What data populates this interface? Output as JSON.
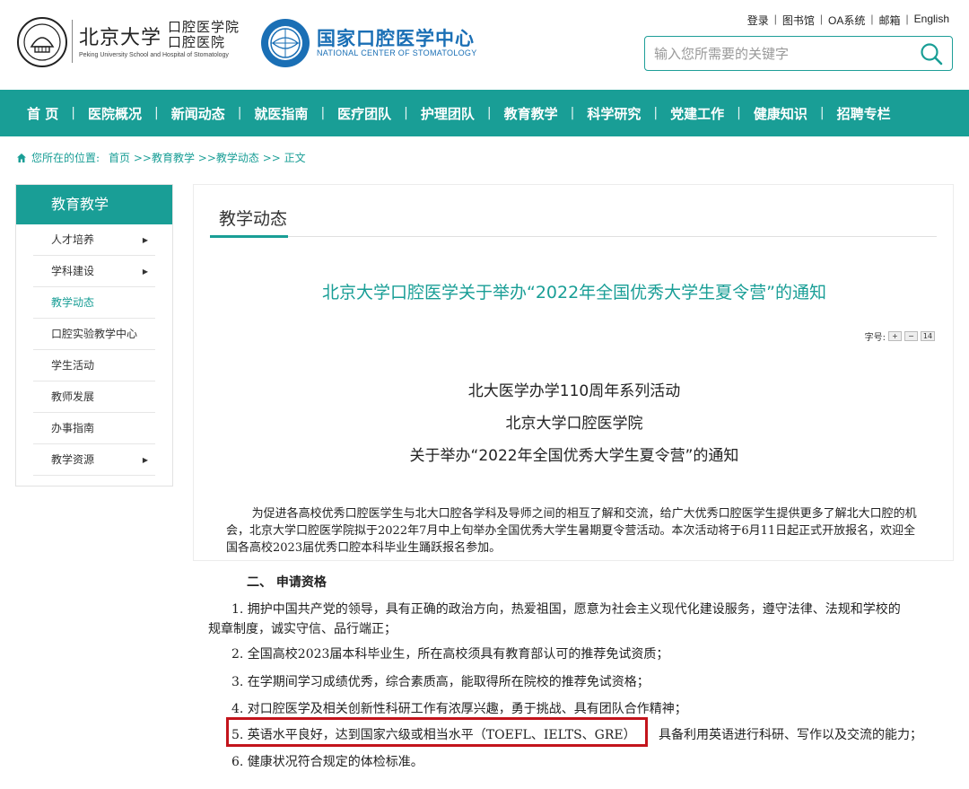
{
  "header": {
    "pku_name": "北京大学",
    "pku_school_cn": "口腔医学院 口腔医院",
    "pku_school_en": "Peking University School and Hospital of Stomatology",
    "ncs_name_cn": "国家口腔医学中心",
    "ncs_name_en": "NATIONAL CENTER OF STOMATOLOGY",
    "top_links": [
      "登录",
      "图书馆",
      "OA系统",
      "邮箱",
      "English"
    ],
    "search_placeholder": "输入您所需要的关键字",
    "brand_color": "#199e96",
    "ncs_color": "#1a6fb5"
  },
  "nav": {
    "items": [
      "首 页",
      "医院概况",
      "新闻动态",
      "就医指南",
      "医疗团队",
      "护理团队",
      "教育教学",
      "科学研究",
      "党建工作",
      "健康知识",
      "招聘专栏"
    ]
  },
  "breadcrumb": {
    "prefix": "您所在的位置:",
    "path": "首页 >>教育教学 >>教学动态 >> 正文"
  },
  "sidebar": {
    "title": "教育教学",
    "items": [
      {
        "label": "人才培养",
        "has_arrow": true
      },
      {
        "label": "学科建设",
        "has_arrow": true
      },
      {
        "label": "教学动态",
        "active": true
      },
      {
        "label": "口腔实验教学中心"
      },
      {
        "label": "学生活动"
      },
      {
        "label": "教师发展"
      },
      {
        "label": "办事指南"
      },
      {
        "label": "教学资源",
        "has_arrow": true
      }
    ]
  },
  "main": {
    "section_title": "教学动态",
    "article_title": "北京大学口腔医学关于举办“2022年全国优秀大学生夏令营”的通知",
    "font_size_label": "字号:",
    "font_size_plus": "+",
    "font_size_minus": "−",
    "font_size_value": "14",
    "heading_lines": [
      "北大医学办学110周年系列活动",
      "北京大学口腔医学院",
      "关于举办“2022年全国优秀大学生夏令营”的通知"
    ],
    "intro": "为促进各高校优秀口腔医学生与北大口腔各学科及导师之间的相互了解和交流，给广大优秀口腔医学生提供更多了解北大口腔的机会，北京大学口腔医学院拟于2022年7月中上旬举办全国优秀大学生暑期夏令营活动。本次活动将于6月11日起正式开放报名，欢迎全国各高校2023届优秀口腔本科毕业生踊跃报名参加。"
  },
  "requirements": {
    "section": "二、 申请资格",
    "item1_a": "1. 拥护中国共产党的领导，具有正确的政治方向，热爱祖国，愿意为社会主义现代化建设服务，遵守法律、法规和学校的",
    "item1_b": "规章制度，诚实守信、品行端正；",
    "item2": "2. 全国高校2023届本科毕业生，所在高校须具有教育部认可的推荐免试资质；",
    "item3": "3. 在学期间学习成绩优秀，综合素质高，能取得所在院校的推荐免试资格；",
    "item4": "4. 对口腔医学及相关创新性科研工作有浓厚兴趣，勇于挑战、具有团队合作精神；",
    "item5_a": "5. 英语水平良好，达到国家六级或相当水平（TOEFL、IELTS、GRE）",
    "item5_b": "具备利用英语进行科研、写作以及交流的能力；",
    "item6": "6. 健康状况符合规定的体检标准。",
    "highlight_color": "#c3141c"
  }
}
